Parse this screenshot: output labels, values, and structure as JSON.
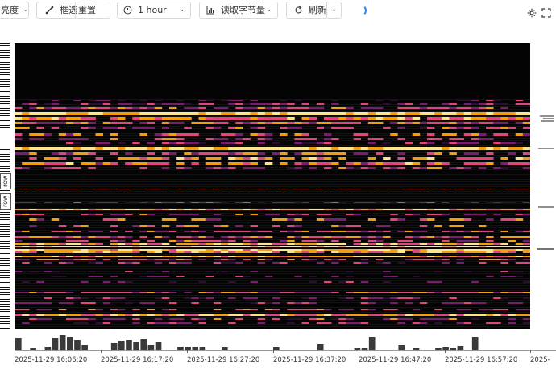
{
  "toolbar": {
    "brightness_label": "亮度",
    "select_label": "框选",
    "reset_label": "重置",
    "time_range": "1 hour",
    "metric": "读取字节量",
    "refresh_label": "刷新"
  },
  "side_labels": [
    "row",
    "row"
  ],
  "x_axis": {
    "tick_labels": [
      "2025-11-29 16:06:20",
      "2025-11-29 16:17:20",
      "2025-11-29 16:27:20",
      "2025-11-29 16:37:20",
      "2025-11-29 16:47:20",
      "2025-11-29 16:57:20",
      "2025-"
    ]
  },
  "colors": {
    "background": "#040404",
    "hot": "#fde68a",
    "warm": "#f59e0b",
    "mid": "#e0457b",
    "cool": "#7b1d6f",
    "cold": "#2a0f2f",
    "accent": "#1890ff",
    "histogram": "#3a3a3a"
  }
}
